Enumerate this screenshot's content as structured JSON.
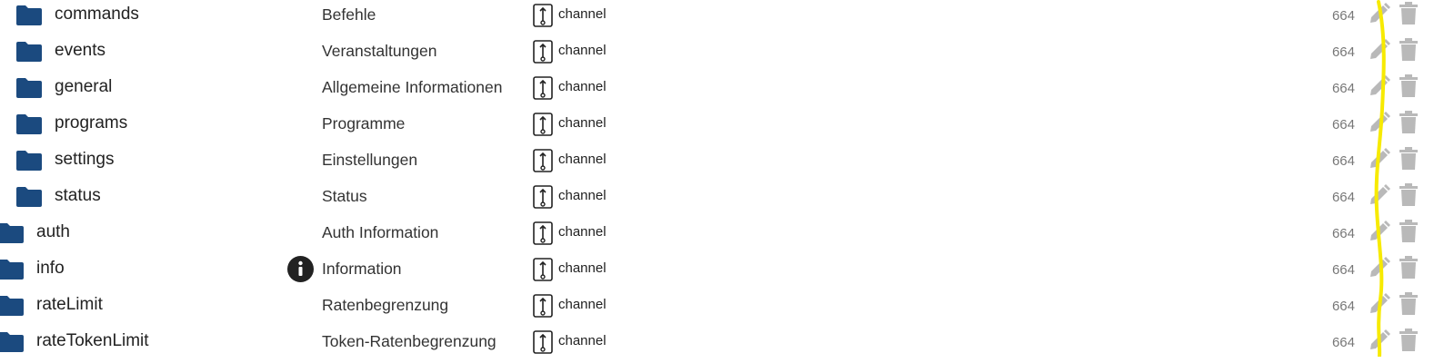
{
  "colors": {
    "folder": "#1b4a7f",
    "action_icons": "#b9b9b9",
    "highlight_line": "#f7ea00"
  },
  "rows": [
    {
      "name": "commands",
      "description": "Befehle",
      "type": "channel",
      "value": "664",
      "icon": "folder-icon",
      "info": false
    },
    {
      "name": "events",
      "description": "Veranstaltungen",
      "type": "channel",
      "value": "664",
      "icon": "folder-icon",
      "info": false
    },
    {
      "name": "general",
      "description": "Allgemeine Informationen",
      "type": "channel",
      "value": "664",
      "icon": "folder-icon",
      "info": false
    },
    {
      "name": "programs",
      "description": "Programme",
      "type": "channel",
      "value": "664",
      "icon": "folder-icon",
      "info": false
    },
    {
      "name": "settings",
      "description": "Einstellungen",
      "type": "channel",
      "value": "664",
      "icon": "folder-icon",
      "info": false
    },
    {
      "name": "status",
      "description": "Status",
      "type": "channel",
      "value": "664",
      "icon": "folder-icon",
      "info": false
    },
    {
      "name": "auth",
      "description": "Auth Information",
      "type": "channel",
      "value": "664",
      "icon": "folder-icon",
      "info": false
    },
    {
      "name": "info",
      "description": "Information",
      "type": "channel",
      "value": "664",
      "icon": "folder-icon",
      "info": true
    },
    {
      "name": "rateLimit",
      "description": "Ratenbegrenzung",
      "type": "channel",
      "value": "664",
      "icon": "folder-icon",
      "info": false
    },
    {
      "name": "rateTokenLimit",
      "description": "Token-Ratenbegrenzung",
      "type": "channel",
      "value": "664",
      "icon": "folder-icon",
      "info": false
    }
  ]
}
